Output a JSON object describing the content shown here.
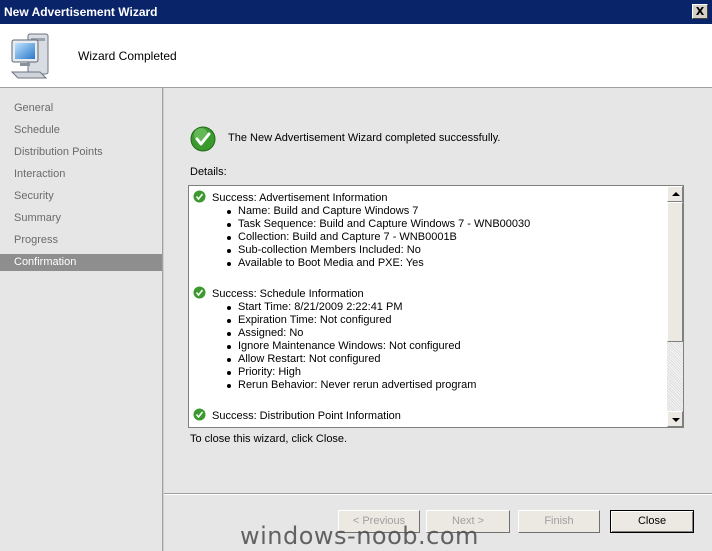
{
  "window": {
    "title": "New Advertisement Wizard",
    "close_glyph": "X"
  },
  "header": {
    "text": "Wizard Completed",
    "icon": "computer-icon"
  },
  "sidebar": {
    "items": [
      {
        "label": "General"
      },
      {
        "label": "Schedule"
      },
      {
        "label": "Distribution Points"
      },
      {
        "label": "Interaction"
      },
      {
        "label": "Security"
      },
      {
        "label": "Summary"
      },
      {
        "label": "Progress"
      },
      {
        "label": "Confirmation",
        "active": true
      }
    ]
  },
  "main": {
    "success_message": "The New Advertisement Wizard completed successfully.",
    "details_label": "Details:",
    "close_hint": "To close this wizard, click Close."
  },
  "details": [
    {
      "title": "Success: Advertisement Information",
      "items": [
        "Name: Build and Capture Windows 7",
        "Task Sequence: Build and Capture Windows 7 - WNB00030",
        "Collection: Build and Capture 7 - WNB0001B",
        "Sub-collection Members Included: No",
        "Available to Boot Media and PXE: Yes"
      ]
    },
    {
      "title": "Success: Schedule Information",
      "items": [
        "Start Time: 8/21/2009 2:22:41 PM",
        "Expiration Time: Not configured",
        "Assigned: No",
        "Ignore Maintenance Windows: Not configured",
        "Allow Restart: Not configured",
        "Priority: High",
        "Rerun Behavior: Never rerun advertised program"
      ]
    },
    {
      "title": "Success: Distribution Point Information",
      "items": []
    }
  ],
  "buttons": {
    "previous": "< Previous",
    "next": "Next >",
    "finish": "Finish",
    "close": "Close"
  },
  "watermark": "windows-noob.com",
  "colors": {
    "titlebar": "#0a246a",
    "active_nav": "#8e8e8e",
    "success_green": "#3a9a2e"
  }
}
